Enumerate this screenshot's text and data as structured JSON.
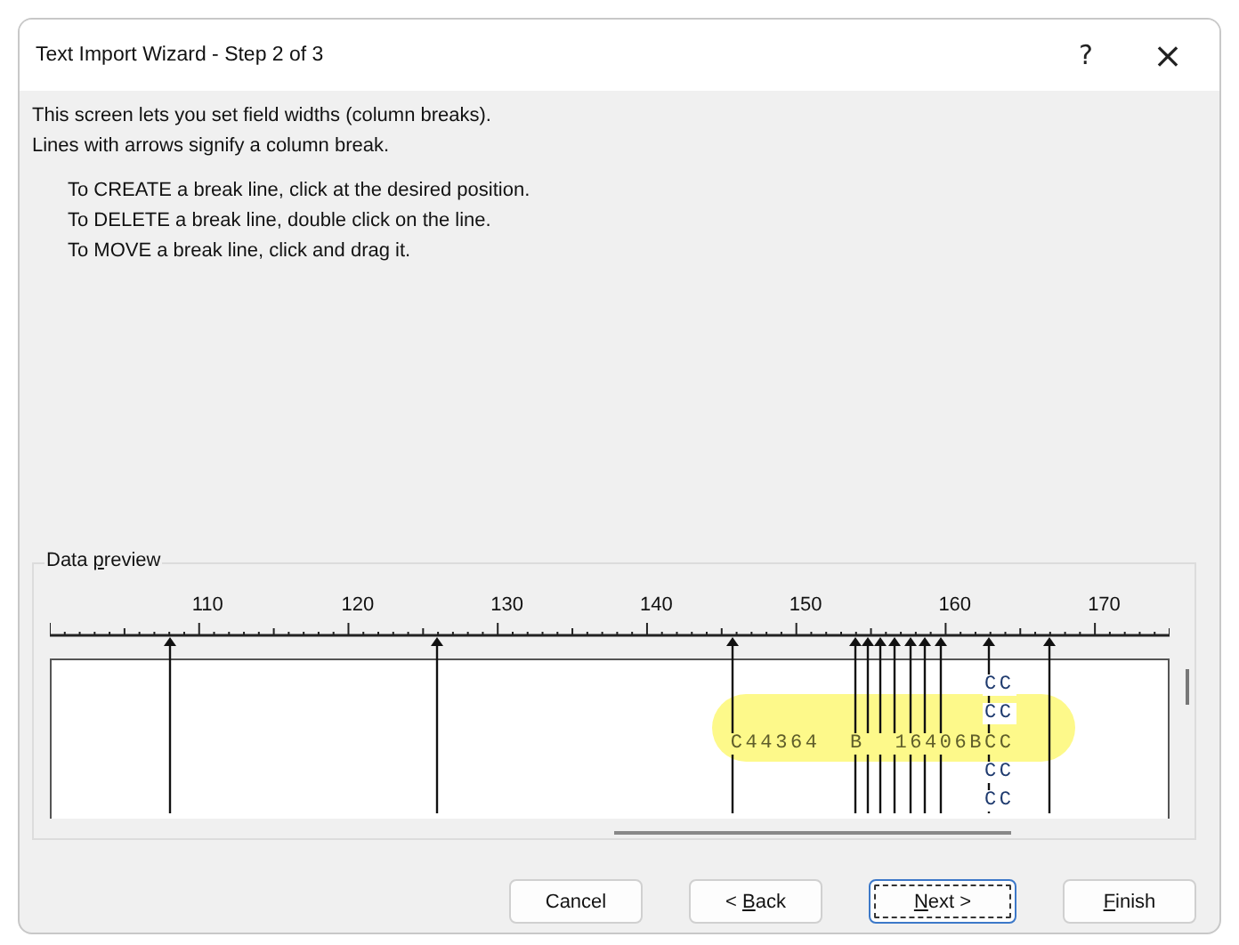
{
  "window": {
    "title": "Text Import Wizard - Step 2 of 3",
    "help": "?",
    "close": "×"
  },
  "intro": [
    "This screen lets you set field widths (column breaks).",
    "Lines with arrows signify a column break."
  ],
  "instructions": [
    "To CREATE a break line, click at the desired position.",
    "To DELETE a break line, double click on the line.",
    "To MOVE a break line, click and drag it."
  ],
  "preview": {
    "label_parts": [
      "Data ",
      "p",
      "review"
    ],
    "ruler_labels": [
      "110",
      "120",
      "130",
      "140",
      "150",
      "160",
      "170"
    ],
    "breaks": [
      {
        "level": 0.107
      },
      {
        "level": 0.345
      },
      {
        "level": 0.61
      },
      {
        "level": 0.719
      },
      {
        "level": 0.73
      },
      {
        "level": 0.742
      },
      {
        "level": 0.755
      },
      {
        "level": 0.768
      },
      {
        "level": 0.781
      },
      {
        "level": 0.795
      },
      {
        "level": 0.839
      },
      {
        "level": 0.892
      }
    ],
    "rows": [
      {
        "text": "                                                              CC",
        "highlighted": false
      },
      {
        "text": "                                                              CC",
        "highlighted": false
      },
      {
        "text": "                                             C44364  B  16406BCC",
        "highlighted": true
      },
      {
        "text": "                                                              CC",
        "highlighted": false
      },
      {
        "text": "                                                              CC",
        "highlighted": false
      }
    ]
  },
  "buttons": [
    {
      "before": "Cancel",
      "focused": false
    },
    {
      "before": "< ",
      "key": "B",
      "after": "ack",
      "focused": false
    },
    {
      "key": "N",
      "after": "ext >",
      "focused": true
    },
    {
      "key": "F",
      "after": "inish",
      "focused": false
    }
  ]
}
